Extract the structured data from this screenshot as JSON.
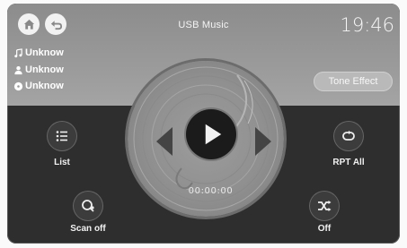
{
  "header": {
    "title": "USB Music",
    "clock": "19:46"
  },
  "track": {
    "song": "Unknow",
    "artist": "Unknow",
    "album": "Unknow"
  },
  "tone_effect_label": "Tone Effect",
  "playback": {
    "time": "00:00:00"
  },
  "controls": {
    "list_label": "List",
    "repeat_label": "RPT All",
    "scan_label": "Scan off",
    "shuffle_label": "Off"
  },
  "icons": {
    "home": "home-icon",
    "back": "back-icon",
    "song": "music-note-icon",
    "artist": "person-icon",
    "album": "disc-icon",
    "play": "play-icon",
    "prev": "previous-icon",
    "next": "next-icon",
    "list": "list-icon",
    "repeat": "repeat-icon",
    "scan": "scan-icon",
    "shuffle": "shuffle-icon"
  },
  "colors": {
    "top_panel": "#9a9a9a",
    "body": "#2e2e2e",
    "play_button": "#1b1b1b"
  }
}
